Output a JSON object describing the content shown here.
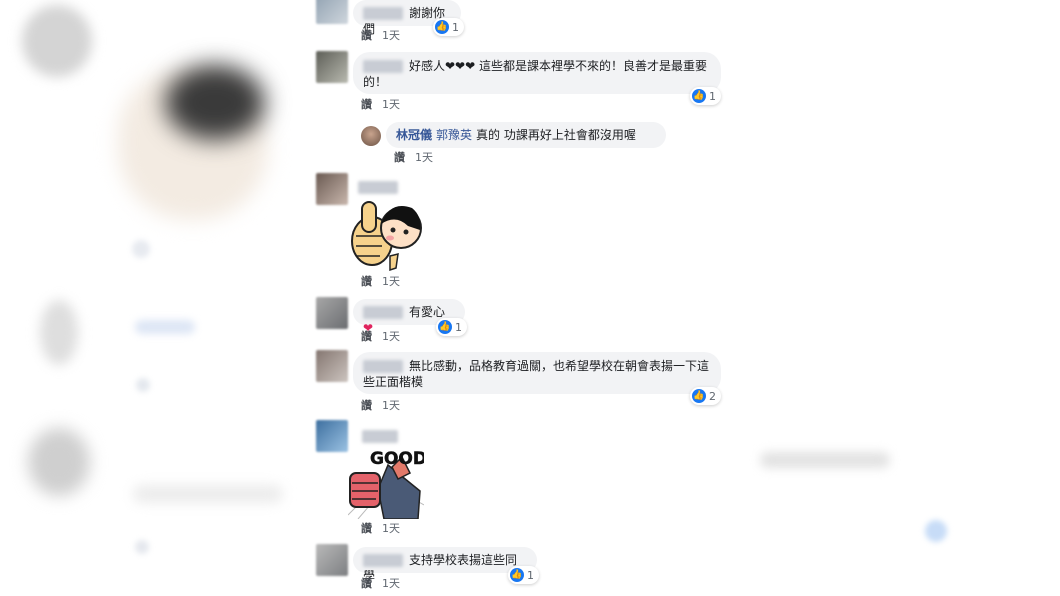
{
  "comments": [
    {
      "text": "謝謝你們",
      "meta_like": "讚",
      "meta_time": "1天",
      "reactions": "1"
    },
    {
      "text": "好感人❤❤❤ 這些都是課本裡學不來的！良善才是最重要的！",
      "meta_like": "讚",
      "meta_time": "1天",
      "reactions": "1"
    },
    {
      "reply_name": "林冠儀",
      "reply_mention": "郭豫英",
      "reply_text": "真的 功課再好上社會都沒用喔",
      "meta_like": "讚",
      "meta_time": "1天"
    },
    {
      "meta_like": "讚",
      "meta_time": "1天"
    },
    {
      "text": "有愛心",
      "meta_like": "讚",
      "meta_time": "1天",
      "reactions": "1"
    },
    {
      "text": "無比感動，品格教育過關，也希望學校在朝會表揚一下這些正面楷模",
      "meta_like": "讚",
      "meta_time": "1天",
      "reactions": "2"
    },
    {
      "sticker_text": "GOOD",
      "meta_like": "讚",
      "meta_time": "1天"
    },
    {
      "text": "支持學校表揚這些同學",
      "meta_like": "讚",
      "meta_time": "1天",
      "reactions": "1"
    }
  ],
  "icons": {
    "like": "thumbs-up-icon",
    "heart": "heart-icon"
  },
  "colors": {
    "like_blue": "#1877f2",
    "link": "#385898",
    "bubble": "#f2f3f5"
  }
}
